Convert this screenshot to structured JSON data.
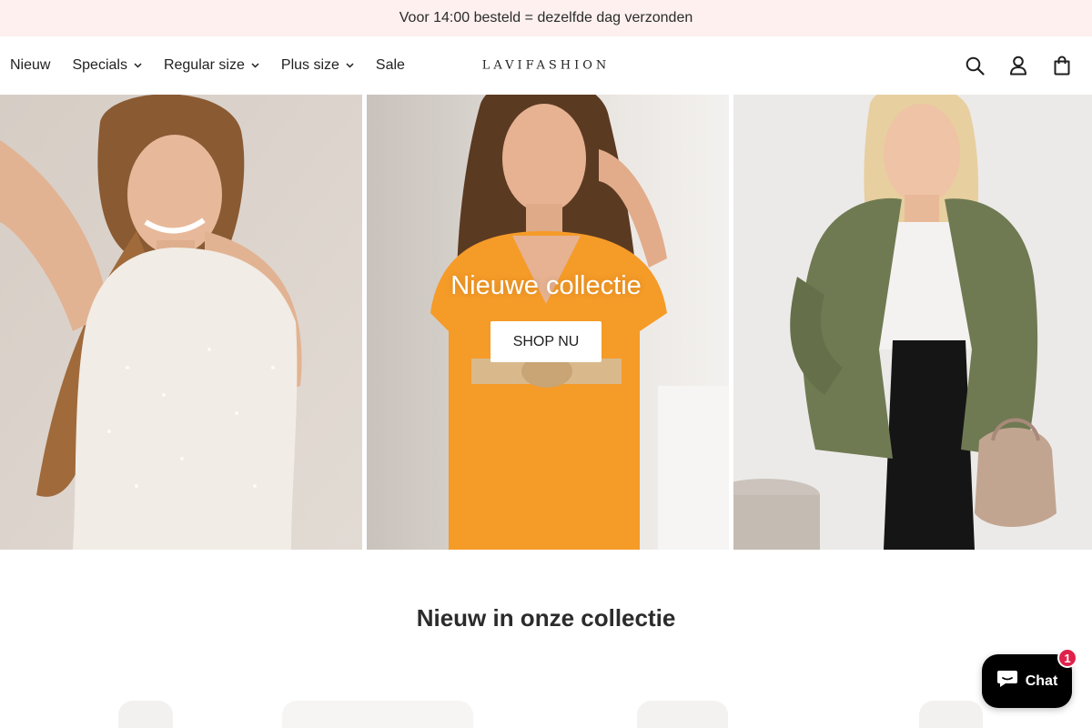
{
  "announcement": {
    "text": "Voor 14:00 besteld = dezelfde dag verzonden"
  },
  "header": {
    "nav": [
      {
        "label": "Nieuw",
        "has_dropdown": false
      },
      {
        "label": "Specials",
        "has_dropdown": true
      },
      {
        "label": "Regular size",
        "has_dropdown": true
      },
      {
        "label": "Plus size",
        "has_dropdown": true
      },
      {
        "label": "Sale",
        "has_dropdown": false
      }
    ],
    "logo": "LAVIFASHION",
    "icons": [
      "search-icon",
      "account-icon",
      "cart-icon"
    ]
  },
  "hero": {
    "title": "Nieuwe collectie",
    "button_label": "SHOP NU"
  },
  "section": {
    "title": "Nieuw in onze collectie"
  },
  "chat": {
    "label": "Chat",
    "badge_count": "1",
    "badge_color": "#e0224b"
  },
  "colors": {
    "announcement_bg": "#fdf0ef",
    "chat_bg": "#000000"
  }
}
